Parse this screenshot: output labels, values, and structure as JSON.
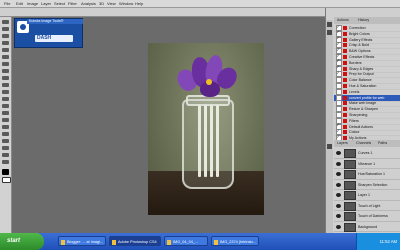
{
  "app": {
    "menu": [
      "File",
      "Edit",
      "Image",
      "Layer",
      "Select",
      "Filter",
      "Analysis",
      "3D",
      "View",
      "Window",
      "Help"
    ]
  },
  "badge": {
    "title": "Kubota Image Tools®",
    "dash_text": "DASH"
  },
  "actions_panel": {
    "tabs": [
      "Actions",
      "History"
    ],
    "items": [
      {
        "label": "Correction",
        "checked": true
      },
      {
        "label": "Bright Colors",
        "checked": true
      },
      {
        "label": "Gallery Effects",
        "checked": true
      },
      {
        "label": "Crisp & Bold",
        "checked": true
      },
      {
        "label": "B&W Options",
        "checked": true
      },
      {
        "label": "Creative Effects",
        "checked": true
      },
      {
        "label": "Borders",
        "checked": true
      },
      {
        "label": "Sharp & Edges",
        "checked": true
      },
      {
        "label": "Prep for Output",
        "checked": true
      },
      {
        "label": "Color Balance",
        "checked": false
      },
      {
        "label": "Hue & Saturation",
        "checked": false
      },
      {
        "label": "Levels",
        "checked": false
      },
      {
        "label": "convert profile for web",
        "checked": false,
        "selected": true
      },
      {
        "label": "Make web image",
        "checked": false
      },
      {
        "label": "Resize & Sharpen",
        "checked": false
      },
      {
        "label": "Sharpening",
        "checked": false
      },
      {
        "label": "Filters",
        "checked": false
      },
      {
        "label": "Default Actions",
        "checked": true
      },
      {
        "label": "Colour",
        "checked": true
      },
      {
        "label": "My Actions",
        "checked": true
      }
    ]
  },
  "layers_panel": {
    "tabs": [
      "Layers",
      "Channels",
      "Paths"
    ],
    "layers": [
      {
        "name": "Curves 1"
      },
      {
        "name": "Vibrance 1"
      },
      {
        "name": "Hue/Saturation 1"
      },
      {
        "name": "Sharpen Selection"
      },
      {
        "name": "Layer 1"
      },
      {
        "name": "Touch of Light"
      },
      {
        "name": "Touch of Darkness"
      },
      {
        "name": "Background"
      }
    ]
  },
  "taskbar": {
    "start_label": "start",
    "tasks": [
      {
        "label": "Blogger: ... at Imagi...",
        "active": false
      },
      {
        "label": "Adobe Photoshop CS4",
        "active": true
      },
      {
        "label": "IMG_04_04_...",
        "active": false
      },
      {
        "label": "IMG_2374 (Intrinsic...",
        "active": false
      }
    ],
    "clock": "11:52 AM"
  },
  "colors": {
    "taskbar": "#1f50b8",
    "start": "#2d8a2a",
    "selection": "#2d5ab8",
    "photo_petal": "#6a2f9e"
  }
}
